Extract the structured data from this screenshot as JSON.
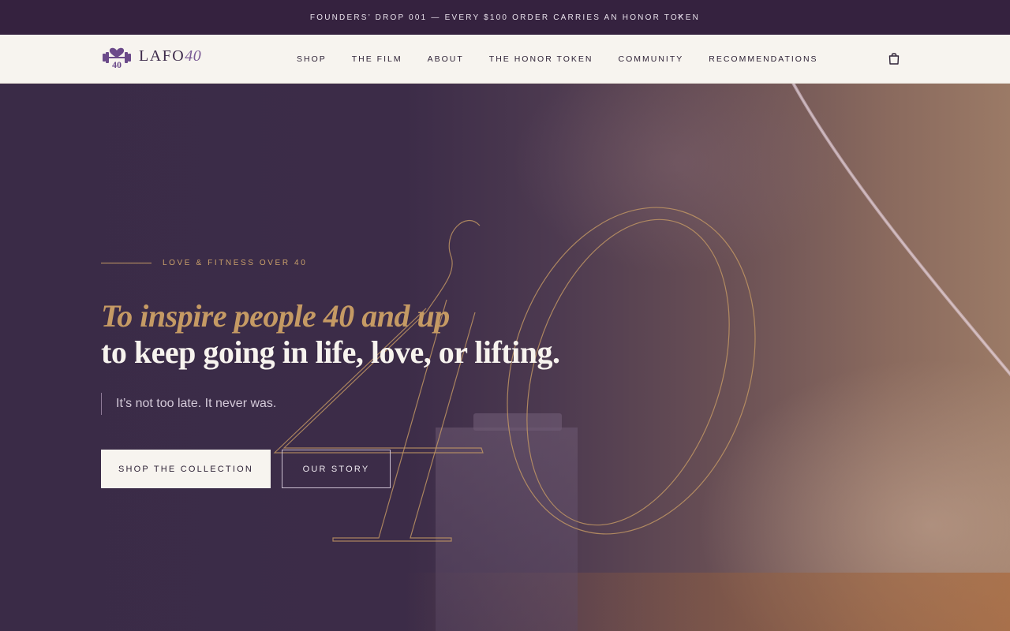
{
  "announcement": {
    "text": "FOUNDERS’ DROP 001 — EVERY $100 ORDER CARRIES AN HONOR TOKEN",
    "close_glyph": "×"
  },
  "header": {
    "logo": {
      "word": "LAFO",
      "number": "40",
      "badge": "40"
    },
    "nav": [
      {
        "label": "SHOP"
      },
      {
        "label": "THE FILM"
      },
      {
        "label": "ABOUT"
      },
      {
        "label": "THE HONOR TOKEN"
      },
      {
        "label": "COMMUNITY"
      },
      {
        "label": "RECOMMENDATIONS"
      }
    ],
    "cart_icon": "shopping-bag-icon"
  },
  "hero": {
    "eyebrow": "LOVE & FITNESS OVER 40",
    "headline_line1": "To inspire people 40 and up",
    "headline_line2": "to keep going in life, love, or lifting.",
    "tagline": "It’s not too late. It never was.",
    "primary_cta": "SHOP THE COLLECTION",
    "secondary_cta": "OUR STORY",
    "decorative_numeral": "40"
  },
  "colors": {
    "announcement_bg": "#35223f",
    "header_bg": "#f7f4ef",
    "hero_bg": "#3a2b47",
    "accent_gold": "#c59a64",
    "brand_purple": "#6b4a8a"
  }
}
